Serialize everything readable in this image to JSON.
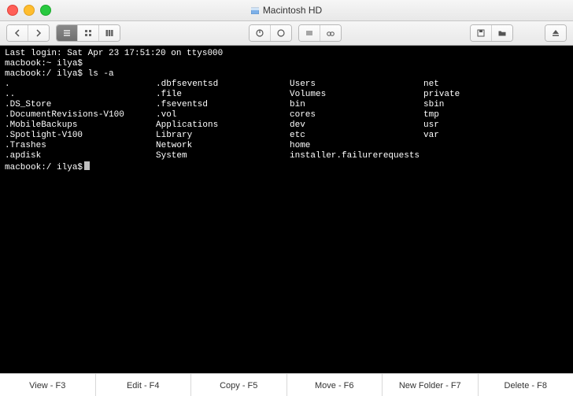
{
  "window": {
    "title": "Macintosh HD"
  },
  "terminal": {
    "lastLogin": "Last login: Sat Apr 23 17:51:20 on ttys000",
    "prompt1": "macbook:~ ilya$",
    "prompt2full": "macbook:/ ilya$ ls -a",
    "prompt3": "macbook:/ ilya$",
    "ls": {
      "col1": [
        ".",
        "..",
        ".DS_Store",
        ".DocumentRevisions-V100",
        ".MobileBackups",
        ".Spotlight-V100",
        ".Trashes",
        ".apdisk"
      ],
      "col2": [
        ".dbfseventsd",
        ".file",
        ".fseventsd",
        ".vol",
        "Applications",
        "Library",
        "Network",
        "System"
      ],
      "col3": [
        "Users",
        "Volumes",
        "bin",
        "cores",
        "dev",
        "etc",
        "home",
        "installer.failurerequests"
      ],
      "col4": [
        "net",
        "private",
        "sbin",
        "tmp",
        "usr",
        "var",
        "",
        ""
      ]
    }
  },
  "footer": {
    "view": "View - F3",
    "edit": "Edit - F4",
    "copy": "Copy - F5",
    "move": "Move - F6",
    "newf": "New Folder - F7",
    "del": "Delete - F8"
  }
}
